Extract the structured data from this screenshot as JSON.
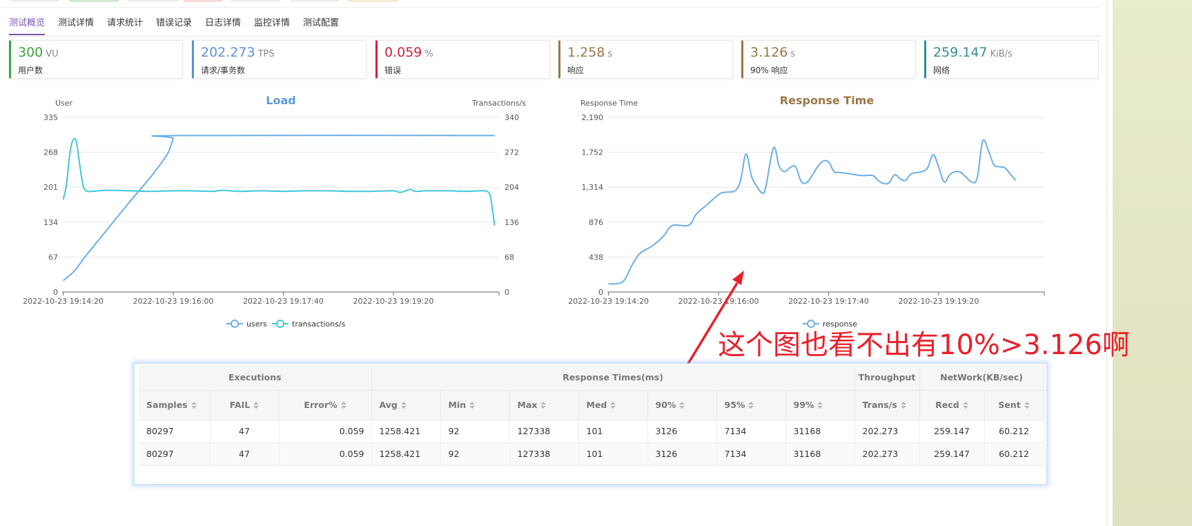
{
  "tabs": [
    "测试概览",
    "测试详情",
    "请求统计",
    "错误记录",
    "日志详情",
    "监控详情",
    "测试配置"
  ],
  "active_tab": 0,
  "cards": [
    {
      "value": "300",
      "unit": "VU",
      "label": "用户数",
      "color": "#3ba53b"
    },
    {
      "value": "202.273",
      "unit": "TPS",
      "label": "请求/事务数",
      "color": "#5b8fd9"
    },
    {
      "value": "0.059",
      "unit": "%",
      "label": "错误",
      "color": "#d0213e"
    },
    {
      "value": "1.258",
      "unit": "s",
      "label": "响应",
      "color": "#9a7646"
    },
    {
      "value": "3.126",
      "unit": "s",
      "label": "90% 响应",
      "color": "#9a7646"
    },
    {
      "value": "259.147",
      "unit": "KiB/s",
      "label": "网络",
      "color": "#2f8f91"
    }
  ],
  "chart_data": [
    {
      "type": "line",
      "title": "Load",
      "title_color": "#5b9bd5",
      "ylabel": "User",
      "ylabel_right": "Transactions/s",
      "ylim": [
        0,
        335
      ],
      "ylim_right": [
        0,
        340
      ],
      "yticks": [
        "0",
        "67",
        "134",
        "201",
        "268",
        "335"
      ],
      "yticks_right": [
        "0",
        "68",
        "136",
        "204",
        "272",
        "340"
      ],
      "xticks": [
        "2022-10-23 19:14:20",
        "2022-10-23 19:16:00",
        "2022-10-23 19:17:40",
        "2022-10-23 19:19:20"
      ],
      "xticks_s": [
        0,
        100,
        200,
        300
      ],
      "xlim_s": [
        -1,
        396
      ],
      "legend": "bottom",
      "legend_items": [
        "users",
        "transactions/s"
      ],
      "series": [
        {
          "name": "users",
          "axis": "left",
          "color": "#6aaee8",
          "points": [
            [
              0,
              22
            ],
            [
              10,
              40
            ],
            [
              20,
              68
            ],
            [
              40,
              120
            ],
            [
              60,
              172
            ],
            [
              80,
              222
            ],
            [
              95,
              266
            ],
            [
              100,
              294
            ],
            [
              105,
              300
            ],
            [
              392,
              300
            ]
          ]
        },
        {
          "name": "transactions/s",
          "axis": "right",
          "color": "#3fc7d9",
          "points": [
            [
              0,
              180
            ],
            [
              3,
              210
            ],
            [
              6,
              270
            ],
            [
              9,
              296
            ],
            [
              12,
              292
            ],
            [
              15,
              248
            ],
            [
              18,
              208
            ],
            [
              21,
              197
            ],
            [
              26,
              196
            ],
            [
              40,
              198
            ],
            [
              60,
              197
            ],
            [
              80,
              196
            ],
            [
              100,
              197
            ],
            [
              115,
              197
            ],
            [
              135,
              196
            ],
            [
              145,
              198
            ],
            [
              160,
              196
            ],
            [
              180,
              197
            ],
            [
              200,
              196
            ],
            [
              220,
              197
            ],
            [
              240,
              197
            ],
            [
              260,
              196
            ],
            [
              280,
              196
            ],
            [
              300,
              197
            ],
            [
              305,
              194
            ],
            [
              310,
              196
            ],
            [
              315,
              200
            ],
            [
              320,
              196
            ],
            [
              330,
              197
            ],
            [
              350,
              197
            ],
            [
              365,
              196
            ],
            [
              380,
              197
            ],
            [
              385,
              196
            ],
            [
              388,
              188
            ],
            [
              390,
              160
            ],
            [
              392,
              130
            ]
          ]
        }
      ]
    },
    {
      "type": "line",
      "title": "Response Time",
      "title_color": "#9a7646",
      "ylabel": "Response Time",
      "ylim": [
        0,
        2190
      ],
      "yticks": [
        "0",
        "438",
        "876",
        "1,314",
        "1,752",
        "2,190"
      ],
      "xticks": [
        "2022-10-23 19:14:20",
        "2022-10-23 19:16:00",
        "2022-10-23 19:17:40",
        "2022-10-23 19:19:20"
      ],
      "xticks_s": [
        0,
        100,
        200,
        300
      ],
      "xlim_s": [
        -1,
        396
      ],
      "legend": "bottom",
      "legend_items": [
        "response"
      ],
      "series": [
        {
          "name": "response",
          "color": "#6aaee8",
          "points": [
            [
              0,
              100
            ],
            [
              10,
              110
            ],
            [
              15,
              160
            ],
            [
              20,
              300
            ],
            [
              25,
              420
            ],
            [
              30,
              500
            ],
            [
              40,
              580
            ],
            [
              50,
              700
            ],
            [
              55,
              800
            ],
            [
              60,
              840
            ],
            [
              70,
              830
            ],
            [
              75,
              860
            ],
            [
              80,
              980
            ],
            [
              90,
              1100
            ],
            [
              100,
              1220
            ],
            [
              105,
              1250
            ],
            [
              115,
              1270
            ],
            [
              120,
              1400
            ],
            [
              125,
              1730
            ],
            [
              130,
              1450
            ],
            [
              135,
              1320
            ],
            [
              140,
              1240
            ],
            [
              143,
              1320
            ],
            [
              150,
              1810
            ],
            [
              155,
              1580
            ],
            [
              160,
              1510
            ],
            [
              165,
              1560
            ],
            [
              170,
              1570
            ],
            [
              175,
              1390
            ],
            [
              180,
              1370
            ],
            [
              185,
              1460
            ],
            [
              190,
              1570
            ],
            [
              195,
              1640
            ],
            [
              200,
              1630
            ],
            [
              205,
              1510
            ],
            [
              210,
              1500
            ],
            [
              220,
              1480
            ],
            [
              230,
              1460
            ],
            [
              240,
              1460
            ],
            [
              245,
              1400
            ],
            [
              250,
              1360
            ],
            [
              255,
              1370
            ],
            [
              260,
              1470
            ],
            [
              265,
              1420
            ],
            [
              270,
              1400
            ],
            [
              275,
              1480
            ],
            [
              285,
              1510
            ],
            [
              290,
              1560
            ],
            [
              295,
              1720
            ],
            [
              300,
              1570
            ],
            [
              305,
              1380
            ],
            [
              310,
              1470
            ],
            [
              315,
              1510
            ],
            [
              320,
              1500
            ],
            [
              325,
              1440
            ],
            [
              330,
              1380
            ],
            [
              335,
              1430
            ],
            [
              340,
              1890
            ],
            [
              345,
              1780
            ],
            [
              350,
              1600
            ],
            [
              355,
              1570
            ],
            [
              360,
              1560
            ],
            [
              365,
              1480
            ],
            [
              370,
              1400
            ]
          ]
        }
      ]
    }
  ],
  "annotation": "这个图也看不出有10%>3.126啊",
  "table": {
    "groups": [
      {
        "label": "Executions",
        "span": 3
      },
      {
        "label": "Response Times(ms)",
        "span": 7
      },
      {
        "label": "Throughput",
        "span": 1
      },
      {
        "label": "NetWork(KB/sec)",
        "span": 2
      }
    ],
    "columns": [
      "Samples",
      "FAIL",
      "Error%",
      "Avg",
      "Min",
      "Max",
      "Med",
      "90%",
      "95%",
      "99%",
      "Trans/s",
      "Recd",
      "Sent"
    ],
    "rows": [
      [
        "80297",
        "47",
        "0.059",
        "1258.421",
        "92",
        "127338",
        "101",
        "3126",
        "7134",
        "31168",
        "202.273",
        "259.147",
        "60.212"
      ],
      [
        "80297",
        "47",
        "0.059",
        "1258.421",
        "92",
        "127338",
        "101",
        "3126",
        "7134",
        "31168",
        "202.273",
        "259.147",
        "60.212"
      ]
    ]
  },
  "colors": {
    "accent": "#7b55b0",
    "annotation": "#e8202a"
  }
}
